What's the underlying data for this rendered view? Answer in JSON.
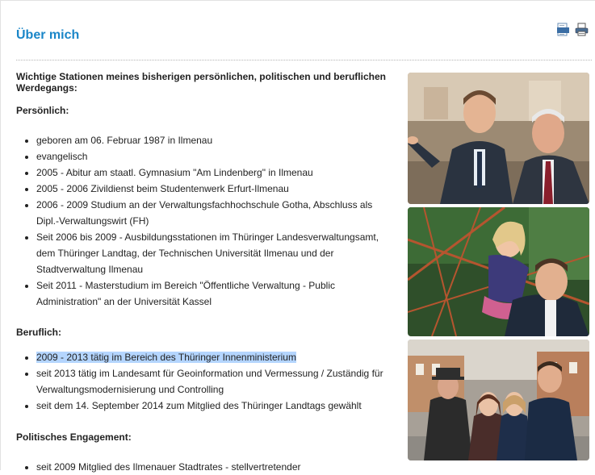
{
  "page": {
    "title": "Über mich",
    "pdf_icon": "pdf-icon",
    "print_icon": "print-icon"
  },
  "intro": "Wichtige Stationen meines bisherigen persönlichen, politischen und beruflichen Werdegangs:",
  "sections": {
    "personal": {
      "heading": "Persönlich:",
      "items": [
        "geboren am 06. Februar 1987 in Ilmenau",
        "evangelisch",
        "2005 - Abitur am staatl. Gymnasium \"Am Lindenberg\" in Ilmenau",
        "2005 - 2006 Zivildienst beim Studentenwerk Erfurt-Ilmenau",
        "2006 - 2009 Studium an der Verwaltungsfachhochschule Gotha, Abschluss als Dipl.-Verwaltungswirt (FH)",
        "Seit 2006 bis 2009  - Ausbildungsstationen im Thüringer Landesverwaltungsamt, dem Thüringer Landtag, der Technischen Universität Ilmenau und der Stadtverwaltung Ilmenau",
        "Seit 2011 - Masterstudium im Bereich \"Öffentliche Verwaltung - Public Administration\" an der Universität Kassel"
      ]
    },
    "professional": {
      "heading": "Beruflich:",
      "items": [
        "2009 - 2013 tätig im Bereich des Thüringer Innenministerium",
        "seit 2013 tätig im Landesamt für Geoinformation und Vermessung / Zuständig für Verwaltungsmodernisierung und Controlling",
        "seit dem 14. September 2014 zum Mitglied des Thüringer Landtags gewählt"
      ]
    },
    "political": {
      "heading": "Politisches Engagement:",
      "items": [
        "seit 2009 Mitglied des Ilmenauer Stadtrates  - stellvertretender"
      ]
    }
  },
  "colors": {
    "title": "#1a86c8",
    "selection": "#b4d5fe"
  }
}
